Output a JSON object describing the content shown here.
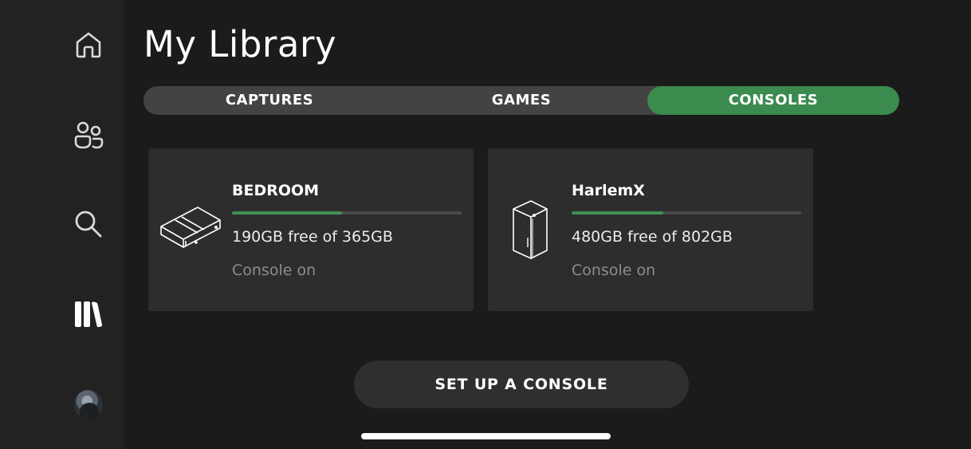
{
  "page": {
    "title": "My Library"
  },
  "sidebar": {
    "items": [
      {
        "name": "home",
        "icon": "home-icon"
      },
      {
        "name": "friends",
        "icon": "people-icon"
      },
      {
        "name": "search",
        "icon": "search-icon"
      },
      {
        "name": "library",
        "icon": "library-icon",
        "selected": true
      },
      {
        "name": "profile",
        "icon": "avatar"
      }
    ]
  },
  "tabs": [
    {
      "label": "CAPTURES",
      "active": false
    },
    {
      "label": "GAMES",
      "active": false
    },
    {
      "label": "CONSOLES",
      "active": true
    }
  ],
  "consoles": [
    {
      "name": "BEDROOM",
      "storage_text": "190GB free of 365GB",
      "free_gb": 190,
      "total_gb": 365,
      "used_fraction": 0.48,
      "status": "Console on",
      "icon": "xbox-one-console-icon"
    },
    {
      "name": "HarlemX",
      "storage_text": "480GB free of 802GB",
      "free_gb": 480,
      "total_gb": 802,
      "used_fraction": 0.4,
      "status": "Console on",
      "icon": "xbox-series-x-console-icon"
    }
  ],
  "actions": {
    "setup_label": "SET UP A CONSOLE"
  },
  "colors": {
    "accent": "#3b8a4e",
    "background": "#1b1b1b",
    "sidebar": "#222222",
    "card": "#2d2d2d"
  }
}
